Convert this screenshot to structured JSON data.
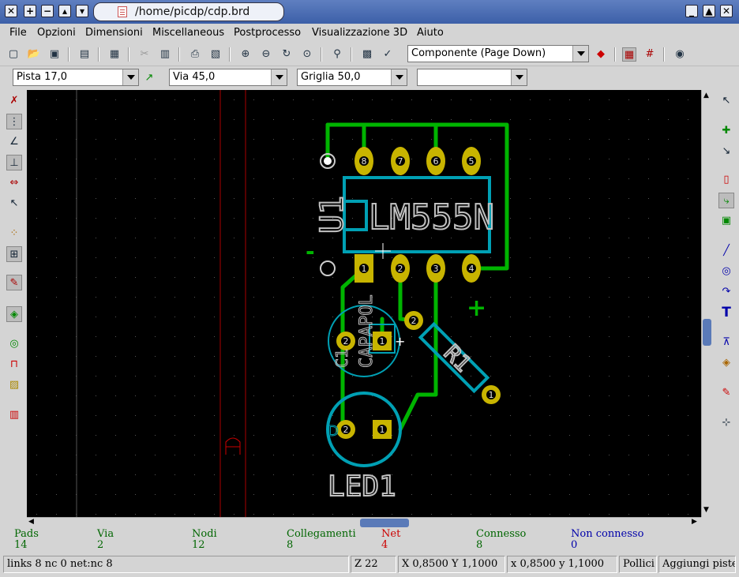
{
  "window": {
    "title": "/home/picdp/cdp.brd"
  },
  "menu": [
    "File",
    "Opzioni",
    "Dimensioni",
    "Miscellaneous",
    "Postprocesso",
    "Visualizzazione 3D",
    "Aiuto"
  ],
  "toolbar": {
    "component_select": "Componente (Page Down)"
  },
  "toolbar2": {
    "track": "Pista 17,0",
    "via": "Via 45,0",
    "grid": "Griglia 50,0",
    "extra": ""
  },
  "board": {
    "u1_ref": "U1",
    "u1_value": "LM555N",
    "c1_label": "C1",
    "c1_value": "CAPAPOL",
    "r1_label": "R1",
    "led_label": "LED1",
    "d_label": "D",
    "minus": "-",
    "plus": "+",
    "cap_plus": "+",
    "pins_top": [
      "8",
      "7",
      "6",
      "5"
    ],
    "pins_bottom": [
      "1",
      "2",
      "3",
      "4"
    ],
    "cap_pins": [
      "2",
      "1"
    ],
    "r_pins": [
      "2",
      "1"
    ],
    "led_pins": [
      "2",
      "1"
    ],
    "colors": {
      "track": "#00c800",
      "pad": "#c8b400",
      "outline": "#00a0b4",
      "silk": "#c0c0c0",
      "edge": "#c80000"
    }
  },
  "info": {
    "labels": [
      "Pads",
      "Via",
      "Nodi",
      "Collegamenti",
      "Net",
      "Connesso",
      "Non connesso"
    ],
    "values": [
      "14",
      "2",
      "12",
      "8",
      "4",
      "8",
      "0"
    ]
  },
  "status": {
    "links": "links 8 nc 0  net:nc 8",
    "zoom": "Z 22",
    "abs": "X 0,8500  Y 1,1000",
    "rel": "x 0,8500  y 1,1000",
    "units": "Pollici",
    "mode": "Aggiungi piste"
  }
}
